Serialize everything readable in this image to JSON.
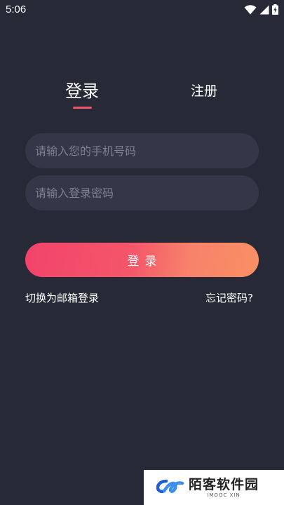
{
  "status_bar": {
    "time": "5:06"
  },
  "tabs": {
    "login": "登录",
    "register": "注册",
    "active": "login",
    "indicator_color": "#f4526a"
  },
  "form": {
    "phone_placeholder": "请输入您的手机号码",
    "password_placeholder": "请输入登录密码",
    "submit_label": "登录"
  },
  "links": {
    "switch_email": "切换为邮箱登录",
    "forgot_password": "忘记密码?"
  },
  "watermark": {
    "name": "陌客软件园",
    "sub": "IMOOC XIN"
  },
  "colors": {
    "background": "#272a36",
    "field_background": "#343747",
    "button_gradient_start": "#f2436a",
    "button_gradient_end": "#f99064"
  },
  "icons": {
    "wifi": "wifi-icon",
    "signal": "signal-icon",
    "battery": "battery-charging-icon"
  }
}
